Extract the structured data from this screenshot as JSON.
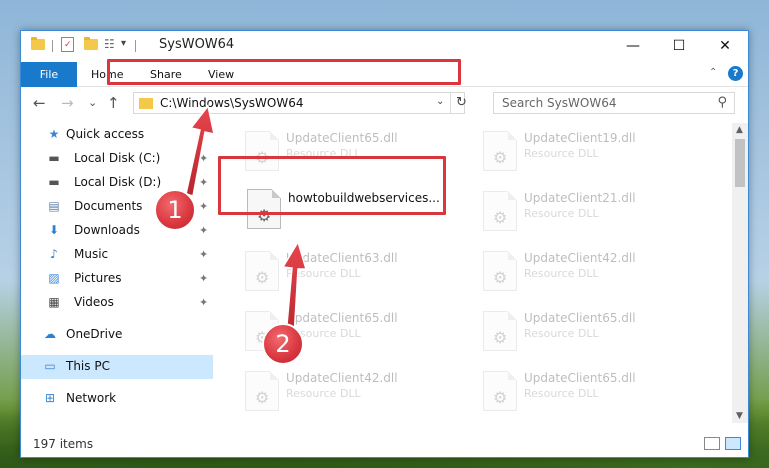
{
  "window": {
    "title": "SysWOW64",
    "minimize_glyph": "—",
    "maximize_glyph": "☐",
    "close_glyph": "✕"
  },
  "ribbon": {
    "file_label": "File",
    "tabs": [
      "Home",
      "Share",
      "View"
    ],
    "help_glyph": "?",
    "collapse_glyph": "⌃"
  },
  "nav": {
    "back_glyph": "←",
    "forward_glyph": "→",
    "recent_glyph": "⌄",
    "up_glyph": "↑",
    "address": "C:\\Windows\\SysWOW64",
    "address_dropdown_glyph": "⌄",
    "refresh_glyph": "↻",
    "search_placeholder": "Search SysWOW64",
    "search_icon_glyph": "⚲"
  },
  "sidebar": {
    "items": [
      {
        "label": "Quick access",
        "icon": "star-icon",
        "glyph": "★",
        "color": "#3a86d6",
        "pinned": false
      },
      {
        "label": "Local Disk (C:)",
        "icon": "drive-icon",
        "glyph": "▬",
        "color": "#555555",
        "pinned": true
      },
      {
        "label": "Local Disk (D:)",
        "icon": "drive-icon",
        "glyph": "▬",
        "color": "#555555",
        "pinned": true
      },
      {
        "label": "Documents",
        "icon": "documents-icon",
        "glyph": "▤",
        "color": "#5a7ea8",
        "pinned": true
      },
      {
        "label": "Downloads",
        "icon": "downloads-icon",
        "glyph": "⬇",
        "color": "#2d7fd0",
        "pinned": true
      },
      {
        "label": "Music",
        "icon": "music-icon",
        "glyph": "♪",
        "color": "#2d7fd0",
        "pinned": true
      },
      {
        "label": "Pictures",
        "icon": "pictures-icon",
        "glyph": "▨",
        "color": "#3a86d6",
        "pinned": true
      },
      {
        "label": "Videos",
        "icon": "videos-icon",
        "glyph": "▦",
        "color": "#444444",
        "pinned": true
      },
      {
        "label": "OneDrive",
        "icon": "cloud-icon",
        "glyph": "☁",
        "color": "#2d7fd0",
        "pinned": false
      },
      {
        "label": "This PC",
        "icon": "computer-icon",
        "glyph": "▭",
        "color": "#3a86d6",
        "pinned": false,
        "selected": true
      },
      {
        "label": "Network",
        "icon": "network-icon",
        "glyph": "⊞",
        "color": "#3a86d6",
        "pinned": false
      }
    ],
    "pin_glyph": "✦"
  },
  "files": [
    {
      "name": "UpdateClient65.dll",
      "type": "Resource DLL",
      "faded": true
    },
    {
      "name": "UpdateClient19.dll",
      "type": "Resource DLL",
      "faded": true
    },
    {
      "name": "howtobuildwebservices...",
      "type": "",
      "faded": false
    },
    {
      "name": "UpdateClient21.dll",
      "type": "Resource DLL",
      "faded": true
    },
    {
      "name": "UpdateClient63.dll",
      "type": "Resource DLL",
      "faded": true
    },
    {
      "name": "UpdateClient42.dll",
      "type": "Resource DLL",
      "faded": true
    },
    {
      "name": "UpdateClient65.dll",
      "type": "Resource DLL",
      "faded": true
    },
    {
      "name": "UpdateClient65.dll",
      "type": "Resource DLL",
      "faded": true
    },
    {
      "name": "UpdateClient42.dll",
      "type": "Resource DLL",
      "faded": true
    },
    {
      "name": "UpdateClient65.dll",
      "type": "Resource DLL",
      "faded": true
    }
  ],
  "file_icon_glyph": "⚙",
  "status": {
    "item_count": "197 items"
  },
  "callouts": [
    "1",
    "2"
  ],
  "colors": {
    "accent": "#1979ca",
    "highlight": "#d9363e",
    "selected": "#cce8ff"
  }
}
